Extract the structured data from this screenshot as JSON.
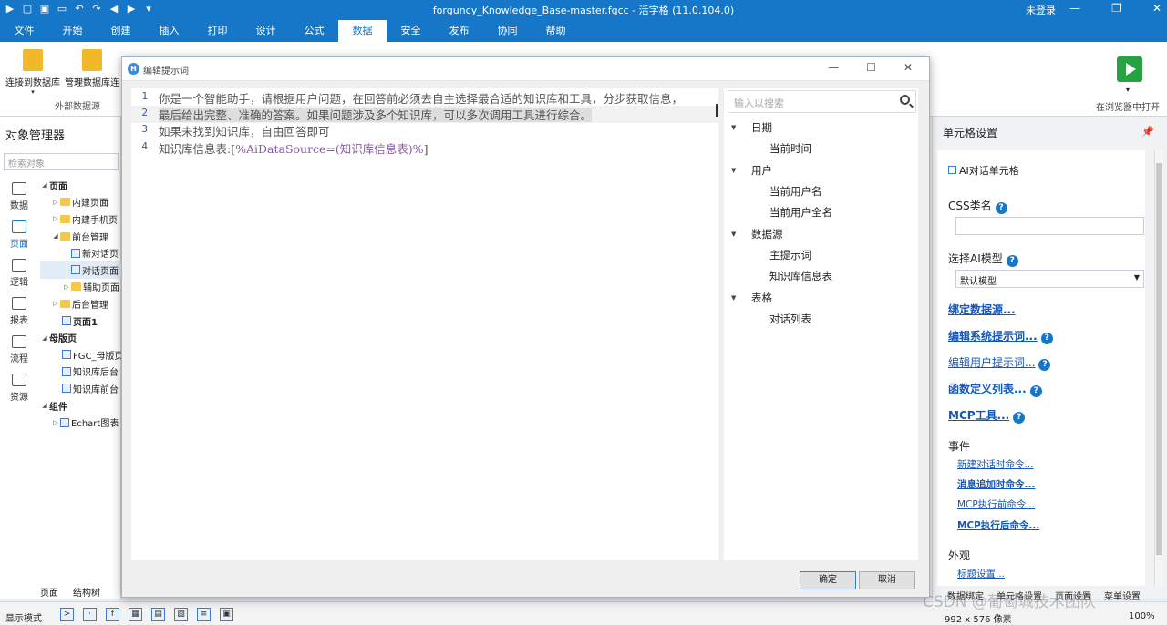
{
  "window": {
    "title": "forguncy_Knowledge_Base-master.fgcc - 活字格 (11.0.104.0)",
    "login": "未登录"
  },
  "menu": [
    "文件",
    "开始",
    "创建",
    "插入",
    "打印",
    "设计",
    "公式",
    "数据",
    "安全",
    "发布",
    "协同",
    "帮助"
  ],
  "ribbon": {
    "btn1": "连接到数据库",
    "btn2": "管理数据库连",
    "group": "外部数据源",
    "run": "在浏览器中打开"
  },
  "left": {
    "title": "对象管理器",
    "search_placeholder": "检索对象",
    "nav": [
      "数据",
      "页面",
      "逻辑",
      "报表",
      "流程",
      "资源"
    ],
    "tree": [
      "页面",
      "内建页面",
      "内建手机页",
      "前台管理",
      "新对话页",
      "对话页面",
      "辅助页面",
      "后台管理",
      "页面1",
      "母版页",
      "FGC_母版页",
      "知识库后台",
      "知识库前台",
      "组件",
      "Echart图表"
    ],
    "tabs": [
      "页面",
      "结构树"
    ]
  },
  "right": {
    "title": "单元格设置",
    "cell_type": "AI对话单元格",
    "css_label": "CSS类名",
    "model_label": "选择AI模型",
    "model_value": "默认模型",
    "bind": "绑定数据源...",
    "sys_prompt": "编辑系统提示词...",
    "user_prompt": "编辑用户提示词...",
    "func": "函数定义列表...",
    "mcp": "MCP工具...",
    "events": "事件",
    "ev1": "新建对话时命令...",
    "ev2": "消息追加时命令...",
    "ev3": "MCP执行前命令...",
    "ev4": "MCP执行后命令...",
    "appearance": "外观",
    "title_set": "标题设置...",
    "tabs": [
      "数据绑定",
      "单元格设置",
      "页面设置",
      "菜单设置"
    ]
  },
  "status": {
    "mode": "显示模式",
    "size": "992 x 576 像素",
    "zoom": "100%",
    "watermark": "CSDN @葡萄城技术团队"
  },
  "dialog": {
    "title": "编辑提示词",
    "lines": [
      {
        "no": "1",
        "text": "你是一个智能助手，请根据用户问题，在回答前必须去自主选择最合适的知识库和工具，分步获取信息，"
      },
      {
        "no": "2",
        "text": "最后给出完整、准确的答案。如果问题涉及多个知识库，可以多次调用工具进行综合。"
      },
      {
        "no": "3",
        "text": "如果未找到知识库，自由回答即可"
      },
      {
        "no": "4",
        "prefix": "知识库信息表:[",
        "var": "%AiDataSource=(知识库信息表)%",
        "suffix": "]"
      }
    ],
    "search_placeholder": "输入以搜索",
    "tree": {
      "g1": "日期",
      "g1a": "当前时间",
      "g2": "用户",
      "g2a": "当前用户名",
      "g2b": "当前用户全名",
      "g3": "数据源",
      "g3a": "主提示词",
      "g3b": "知识库信息表",
      "g4": "表格",
      "g4a": "对话列表"
    },
    "ok": "确定",
    "cancel": "取消"
  }
}
